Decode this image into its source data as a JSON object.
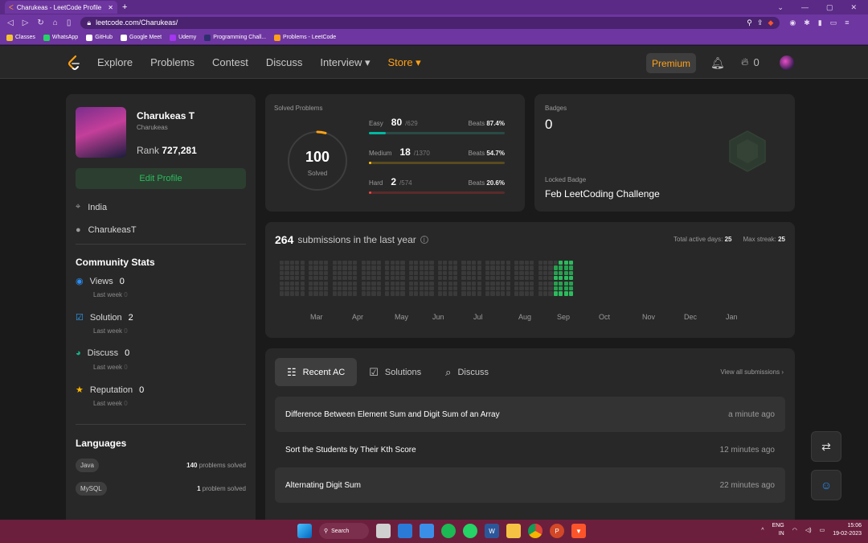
{
  "browser": {
    "tab_title": "Charukeas - LeetCode Profile",
    "url": "leetcode.com/Charukeas/",
    "bookmarks": [
      {
        "label": "Classes",
        "color": "#f4c430"
      },
      {
        "label": "WhatsApp",
        "color": "#25d366"
      },
      {
        "label": "GitHub",
        "color": "#ffffff"
      },
      {
        "label": "Google Meet",
        "color": "#ffffff"
      },
      {
        "label": "Udemy",
        "color": "#a435f0"
      },
      {
        "label": "Programming Chall...",
        "color": "#2e2e6e"
      },
      {
        "label": "Problems - LeetCode",
        "color": "#ffa116"
      }
    ]
  },
  "nav": {
    "links": [
      "Explore",
      "Problems",
      "Contest",
      "Discuss",
      "Interview ▾"
    ],
    "store": "Store ▾",
    "premium": "Premium",
    "streak": "0"
  },
  "profile": {
    "name": "Charukeas T",
    "username": "Charukeas",
    "rank_label": "Rank",
    "rank": "727,281",
    "edit_label": "Edit Profile",
    "location": "India",
    "github": "CharukeasT"
  },
  "community": {
    "title": "Community Stats",
    "last_week": "Last week",
    "items": [
      {
        "label": "Views",
        "value": "0",
        "delta": "0",
        "color": "#2a8cf0"
      },
      {
        "label": "Solution",
        "value": "2",
        "delta": "0",
        "color": "#2a9cf0"
      },
      {
        "label": "Discuss",
        "value": "0",
        "delta": "0",
        "color": "#19b58a"
      },
      {
        "label": "Reputation",
        "value": "0",
        "delta": "0",
        "color": "#ffb800"
      }
    ]
  },
  "languages": {
    "title": "Languages",
    "items": [
      {
        "name": "Java",
        "count": "140",
        "suffix": "problems solved"
      },
      {
        "name": "MySQL",
        "count": "1",
        "suffix": "problem solved"
      }
    ]
  },
  "solved": {
    "title": "Solved Problems",
    "total": "100",
    "total_label": "Solved",
    "total_fraction": 0.0447,
    "beats_label": "Beats",
    "difficulties": [
      {
        "name": "Easy",
        "count": "80",
        "total": "/629",
        "beats": "87.4%",
        "color": "#00b8a3",
        "track": "#2a4a45",
        "fraction": 0.127
      },
      {
        "name": "Medium",
        "count": "18",
        "total": "/1370",
        "beats": "54.7%",
        "color": "#ffc01e",
        "track": "#5a4a1e",
        "fraction": 0.013
      },
      {
        "name": "Hard",
        "count": "2",
        "total": "/574",
        "beats": "20.6%",
        "color": "#ef4743",
        "track": "#5a2a2a",
        "fraction": 0.0035
      }
    ]
  },
  "badges": {
    "title": "Badges",
    "count": "0",
    "locked_label": "Locked Badge",
    "locked_name": "Feb LeetCoding Challenge"
  },
  "submissions": {
    "count": "264",
    "text": "submissions in the last year",
    "active_label": "Total active days:",
    "active_days": "25",
    "streak_label": "Max streak:",
    "max_streak": "25",
    "months": [
      "Mar",
      "Apr",
      "May",
      "Jun",
      "Jul",
      "Aug",
      "Sep",
      "Oct",
      "Nov",
      "Dec",
      "Jan"
    ]
  },
  "recent": {
    "tabs": [
      "Recent AC",
      "Solutions",
      "Discuss"
    ],
    "view_all": "View all submissions",
    "rows": [
      {
        "title": "Difference Between Element Sum and Digit Sum of an Array",
        "time": "a minute ago"
      },
      {
        "title": "Sort the Students by Their Kth Score",
        "time": "12 minutes ago"
      },
      {
        "title": "Alternating Digit Sum",
        "time": "22 minutes ago"
      }
    ]
  },
  "taskbar": {
    "search": "Search",
    "lang": "ENG",
    "region": "IN",
    "time": "15:06",
    "date": "19-02-2023"
  }
}
